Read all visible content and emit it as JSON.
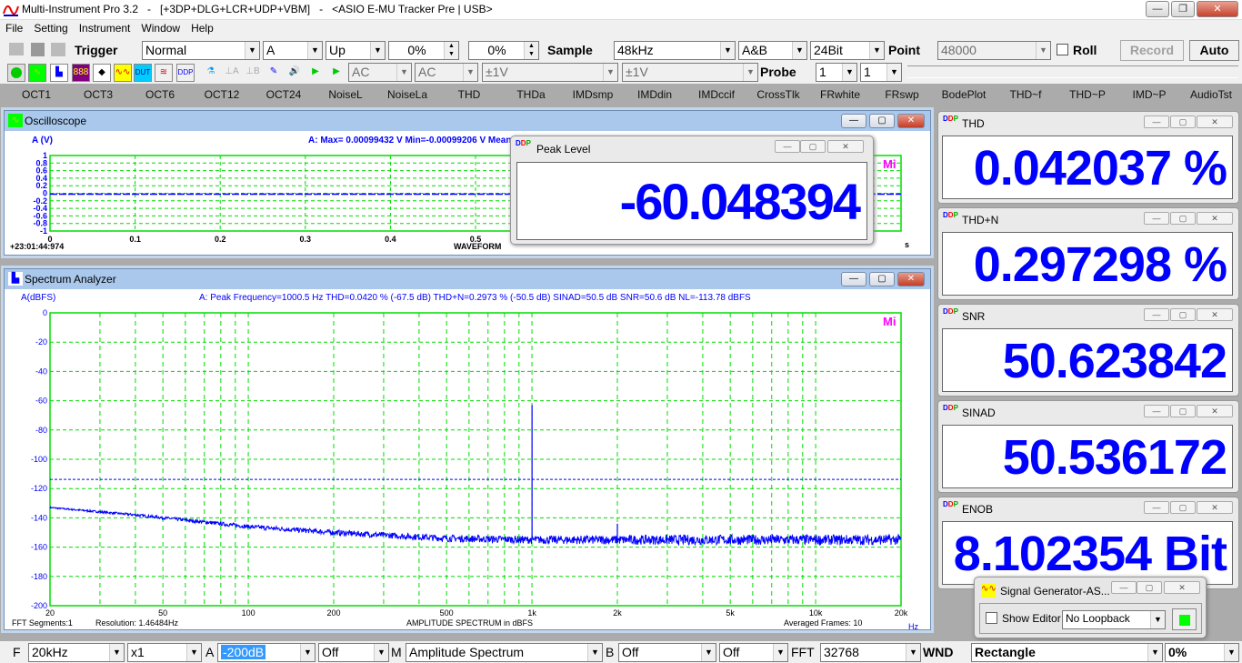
{
  "app": {
    "title": "Multi-Instrument Pro 3.2   -   [+3DP+DLG+LCR+UDP+VBM]   -   <ASIO E-MU Tracker Pre | USB>"
  },
  "menu": [
    "File",
    "Setting",
    "Instrument",
    "Window",
    "Help"
  ],
  "toolbar1": {
    "trigger_label": "Trigger",
    "trigger_mode": "Normal",
    "trigger_channel": "A",
    "trigger_edge": "Up",
    "level1": "0%",
    "level2": "0%",
    "sample_label": "Sample",
    "sample_rate": "48kHz",
    "channels": "A&B",
    "bits": "24Bit",
    "point_label": "Point",
    "points": "48000",
    "roll_label": "Roll",
    "record_label": "Record",
    "auto_label": "Auto"
  },
  "toolbar2": {
    "coupling_a": "AC",
    "coupling_b": "AC",
    "range_a": "±1V",
    "range_b": "±1V",
    "probe_label": "Probe",
    "probe_a": "1",
    "probe_b": "1"
  },
  "functions": [
    "OCT1",
    "OCT3",
    "OCT6",
    "OCT12",
    "OCT24",
    "NoiseL",
    "NoiseLa",
    "THD",
    "THDa",
    "IMDsmp",
    "IMDdin",
    "IMDccif",
    "CrossTlk",
    "FRwhite",
    "FRswp",
    "BodePlot",
    "THD~f",
    "THD~P",
    "IMD~P",
    "AudioTst"
  ],
  "oscilloscope": {
    "title": "Oscilloscope",
    "ylabel": "A (V)",
    "info": "A: Max= 0.00099432 V  Min=-0.00099206 V  Mean=-",
    "timestamp": "+23:01:44:974",
    "xlabel": "WAVEFORM",
    "xunit": "s",
    "watermark": "Mi"
  },
  "peak_level": {
    "title": "Peak Level",
    "value": "-60.048394 dBFS"
  },
  "spectrum": {
    "title": "Spectrum Analyzer",
    "ylabel": "A(dBFS)",
    "info": "A: Peak Frequency=1000.5 Hz  THD=0.0420 % (-67.5 dB)  THD+N=0.2973 % (-50.5 dB)  SINAD=50.5 dB  SNR=50.6 dB  NL=-113.78 dBFS",
    "footer_left1": "FFT  Segments:1",
    "footer_left2": "Resolution: 1.46484Hz",
    "xlabel": "AMPLITUDE SPECTRUM in dBFS",
    "footer_right": "Averaged Frames: 10",
    "xunit": "Hz",
    "watermark": "Mi"
  },
  "panels": [
    {
      "title": "THD",
      "value": "0.042037 %"
    },
    {
      "title": "THD+N",
      "value": "0.297298 %"
    },
    {
      "title": "SNR",
      "value": "50.623842 dB"
    },
    {
      "title": "SINAD",
      "value": "50.536172 dB"
    },
    {
      "title": "ENOB",
      "value": "8.102354 Bit"
    }
  ],
  "signal_generator": {
    "title": "Signal Generator-AS...",
    "show_editor": "Show Editor",
    "loopback": "No Loopback",
    "running_color": "#00ff00"
  },
  "bottombar": {
    "f_label": "F",
    "freq": "20kHz",
    "zoom": "x1",
    "a_label": "A",
    "a_range": "-200dB",
    "a_weight": "Off",
    "m_label": "M",
    "mode": "Amplitude Spectrum",
    "b_label": "B",
    "b_opt1": "Off",
    "b_opt2": "Off",
    "fft_label": "FFT",
    "fft_size": "32768",
    "wnd_label": "WND",
    "window": "Rectangle",
    "overlap": "0%"
  },
  "colors": {
    "trace": "#0000ff",
    "grid": "#00dd00",
    "axis_text": "#0000ff",
    "panel_value": "#0000ff",
    "title_active": "#a9c8ec"
  },
  "chart_data": [
    {
      "type": "line",
      "name_ref": "oscilloscope",
      "ylabel": "A (V)",
      "xlabel": "WAVEFORM",
      "ylim": [
        -1,
        1
      ],
      "xlim": [
        0,
        1
      ],
      "yticks": [
        "1",
        "0.8",
        "0.6",
        "0.4",
        "0.2",
        "0",
        "-0.2",
        "-0.4",
        "-0.6",
        "-0.8",
        "-1"
      ],
      "xticks": [
        "0",
        "0.1",
        "0.2",
        "0.3",
        "0.4",
        "0.5"
      ],
      "grid": true,
      "series": [
        {
          "x": [
            0,
            1
          ],
          "y": [
            0,
            0
          ]
        }
      ]
    },
    {
      "type": "line",
      "name_ref": "spectrum",
      "ylabel": "A(dBFS)",
      "xlabel": "AMPLITUDE SPECTRUM in dBFS",
      "xscale": "log",
      "xlim": [
        20,
        20000
      ],
      "ylim": [
        -200,
        0
      ],
      "yticks": [
        "0",
        "-20",
        "-40",
        "-60",
        "-80",
        "-100",
        "-120",
        "-140",
        "-160",
        "-180",
        "-200"
      ],
      "xticks": [
        {
          "v": 20,
          "l": "20"
        },
        {
          "v": 50,
          "l": "50"
        },
        {
          "v": 100,
          "l": "100"
        },
        {
          "v": 200,
          "l": "200"
        },
        {
          "v": 500,
          "l": "500"
        },
        {
          "v": 1000,
          "l": "1k"
        },
        {
          "v": 2000,
          "l": "2k"
        },
        {
          "v": 5000,
          "l": "5k"
        },
        {
          "v": 10000,
          "l": "10k"
        },
        {
          "v": 20000,
          "l": "20k"
        }
      ],
      "grid": true,
      "noise_floor": {
        "x": [
          20,
          40,
          100,
          200,
          500,
          1000,
          5000,
          20000
        ],
        "y": [
          -133,
          -138,
          -146,
          -150,
          -154,
          -155,
          -155,
          -155
        ]
      },
      "peaks": [
        {
          "x": 1000.5,
          "y": -63
        },
        {
          "x": 2000,
          "y": -144
        }
      ],
      "noise_level_line": -113.78
    }
  ]
}
